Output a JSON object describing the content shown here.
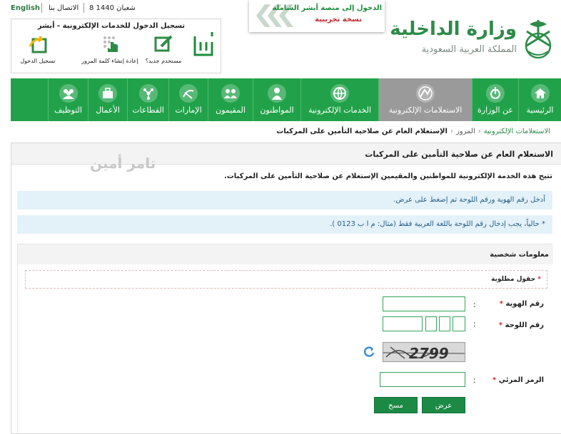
{
  "topbar": {
    "english": "English",
    "contact": "الاتصال بنا",
    "date": "8 شعبان 1440"
  },
  "login": {
    "title": "تسجيل الدخول للخدمات الإلكترونية - أبشر",
    "items": [
      {
        "label": "مستخدم جديد؟",
        "icon": "new-user-icon"
      },
      {
        "label": "إعادة إنشاء كلمة المرور",
        "icon": "password-reset-icon"
      },
      {
        "label": "تسجيل الدخول",
        "icon": "login-icon"
      }
    ]
  },
  "banner": {
    "line1": "الدخول إلى منصة أبشر الشاملة",
    "line2": "نسخة تجريبية"
  },
  "ministry": {
    "name": "وزارة الداخلية",
    "sub": "المملكة العربية السعودية"
  },
  "nav": [
    {
      "label": "الرئيسية",
      "icon": "home-icon"
    },
    {
      "label": "عن الوزارة",
      "icon": "ministry-icon"
    },
    {
      "label": "الاستعلامات الإلكترونية",
      "icon": "inquiries-icon",
      "active": true
    },
    {
      "label": "الخدمات الإلكترونية",
      "icon": "globe-icon"
    },
    {
      "label": "المواطنون",
      "icon": "citizens-icon"
    },
    {
      "label": "المقيمون",
      "icon": "residents-icon"
    },
    {
      "label": "الإمارات",
      "icon": "emirates-icon"
    },
    {
      "label": "القطاعات",
      "icon": "sectors-icon"
    },
    {
      "label": "الأعمال",
      "icon": "business-icon"
    },
    {
      "label": "التوظيف",
      "icon": "jobs-icon"
    }
  ],
  "breadcrumb": {
    "home": "الاستعلامات الإلكترونية",
    "section": "المرور",
    "current": "الإستعلام العام عن صلاحية التأمين على المركبات"
  },
  "page": {
    "title": "الاستعلام العام عن صلاحية التأمين على المركبات",
    "watermark": "تامر أمين",
    "intro": "تتيح هذه الخدمة الإلكترونية للمواطنين والمقيمين الإستعلام عن صلاحية التأمين على المركبات.",
    "info1": "أدخل رقم الهوية ورقم اللوحة ثم إضغط على عرض.",
    "info2": "* حالياً، يجب إدخال رقم اللوحة باللغة العربية فقط (مثال: م ا ب 0123 )."
  },
  "form": {
    "section_title": "معلومات شخصية",
    "required_note": "حقول مطلوبة",
    "id_label": "رقم الهوية",
    "plate_label": "رقم اللوحة",
    "code_label": "الرمز المرئي",
    "colon": ":",
    "star": "*",
    "captcha_text": "2799",
    "id_value": "",
    "code_value": "",
    "submit": "عرض",
    "clear": "مسح"
  },
  "colors": {
    "brand_green": "#21a24a",
    "active_gray": "#9a9a9a",
    "button_green": "#1c8a45",
    "info_bg": "#e3f1f9",
    "required_red": "#d12b2b"
  }
}
